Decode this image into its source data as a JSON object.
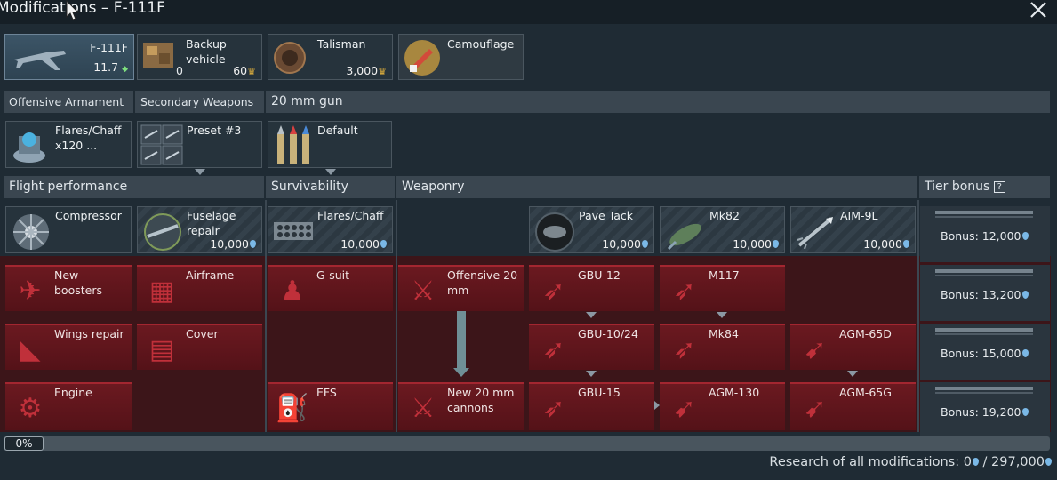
{
  "window": {
    "title": "Modifications – F-111F"
  },
  "top_cards": [
    {
      "label": "F-111F",
      "value": "11.7",
      "value_icon": "br-arrow-icon"
    },
    {
      "label": "Backup vehicle",
      "count": "0",
      "value": "60",
      "value_icon": "golden-eagle-icon"
    },
    {
      "label": "Talisman",
      "value": "3,000",
      "value_icon": "golden-eagle-icon"
    },
    {
      "label": "Camouflage"
    }
  ],
  "weapon_headers": [
    "Offensive Armament",
    "Secondary Weapons",
    "20 mm gun"
  ],
  "weapon_cards": [
    {
      "label": "Flares/Chaff x120 ..."
    },
    {
      "label": "Preset #3"
    },
    {
      "label": "Default"
    }
  ],
  "section_headers": [
    "Flight performance",
    "Survivability",
    "Weaponry",
    "Tier bonus"
  ],
  "tier1": [
    {
      "label": "Compressor"
    },
    {
      "label": "Fuselage repair",
      "value": "10,000"
    },
    {
      "label": "Flares/Chaff",
      "value": "10,000"
    },
    {
      "label": "Pave Tack",
      "value": "10,000"
    },
    {
      "label": "Mk82",
      "value": "10,000"
    },
    {
      "label": "AIM-9L",
      "value": "10,000"
    }
  ],
  "locked": {
    "row1": [
      "New boosters",
      "Airframe",
      "G-suit",
      "Offensive 20 mm",
      "GBU-12",
      "M117"
    ],
    "row2": [
      "Wings repair",
      "Cover",
      "GBU-10/24",
      "Mk84",
      "AGM-65D"
    ],
    "row3": [
      "Engine",
      "EFS",
      "New 20 mm cannons",
      "GBU-15",
      "AGM-130",
      "AGM-65G"
    ]
  },
  "bonuses": [
    "Bonus: 12,000",
    "Bonus: 13,200",
    "Bonus: 15,000",
    "Bonus: 19,200"
  ],
  "progress": {
    "label": "0%",
    "fraction": 0
  },
  "footer": {
    "research_text": "Research of all modifications: 0",
    "research_total": " / 297,000"
  },
  "colors": {
    "locked_red": "#6b1920",
    "research_currency": "#7ab8e6",
    "golden_eagle": "#e3b23c"
  }
}
